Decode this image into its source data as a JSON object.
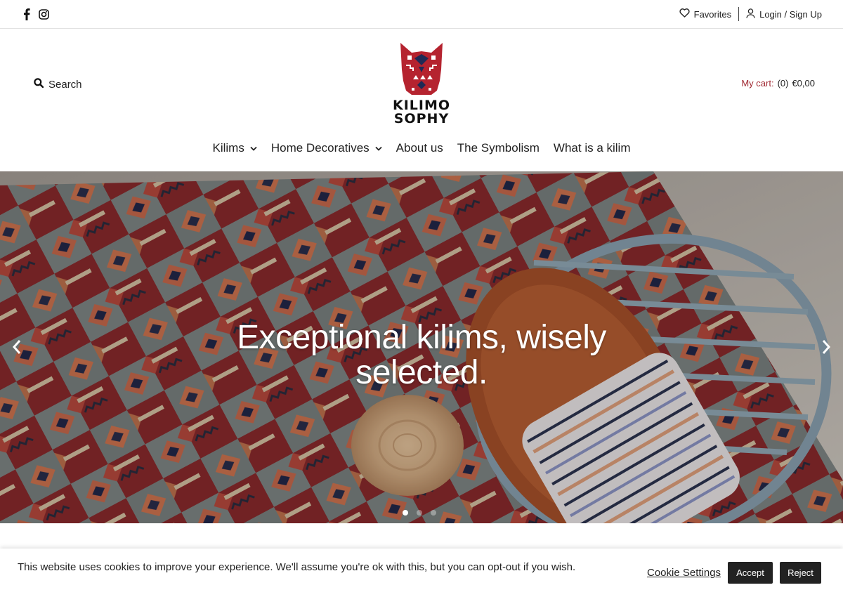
{
  "topbar": {
    "social_icons": [
      "facebook-icon",
      "instagram-icon"
    ],
    "favorites_label": "Favorites",
    "login_label": "Login / Sign Up"
  },
  "header": {
    "search_label": "Search",
    "logo_text_line1": "KILIMO",
    "logo_text_line2": "SOPHY",
    "cart": {
      "label": "My cart:",
      "count": "(0)",
      "amount": "€0,00"
    }
  },
  "nav": {
    "items": [
      {
        "label": "Kilims",
        "has_dropdown": true
      },
      {
        "label": "Home Decoratives",
        "has_dropdown": true
      },
      {
        "label": "About us",
        "has_dropdown": false
      },
      {
        "label": "The Symbolism",
        "has_dropdown": false
      },
      {
        "label": "What is a kilim",
        "has_dropdown": false
      }
    ]
  },
  "hero": {
    "title": "Exceptional kilims, wisely selected.",
    "slides": 3,
    "active_slide": 1
  },
  "cookie": {
    "message": "This website uses cookies to improve your experience. We'll assume you're ok with this, but you can opt-out if you wish.",
    "settings_label": "Cookie Settings",
    "accept_label": "Accept",
    "reject_label": "Reject"
  },
  "colors": {
    "brand_red": "#a12a33",
    "button_dark": "#222222"
  }
}
